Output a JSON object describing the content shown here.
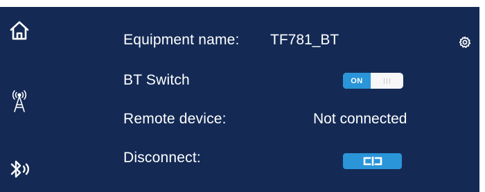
{
  "sidebar": {
    "items": [
      {
        "icon": "home-icon"
      },
      {
        "icon": "antenna-icon"
      },
      {
        "icon": "bluetooth-icon"
      }
    ]
  },
  "header": {
    "settings_icon": "gear-icon"
  },
  "settings": {
    "equipment_name": {
      "label": "Equipment name:",
      "value": "TF781_BT"
    },
    "bt_switch": {
      "label": "BT Switch",
      "state_label": "ON",
      "state": true
    },
    "remote_device": {
      "label": "Remote device:",
      "value": "Not connected"
    },
    "disconnect": {
      "label": "Disconnect:",
      "button_icon": "unlink-icon"
    }
  },
  "colors": {
    "background": "#142a55",
    "accent": "#2a95d8",
    "text": "#ffffff"
  }
}
